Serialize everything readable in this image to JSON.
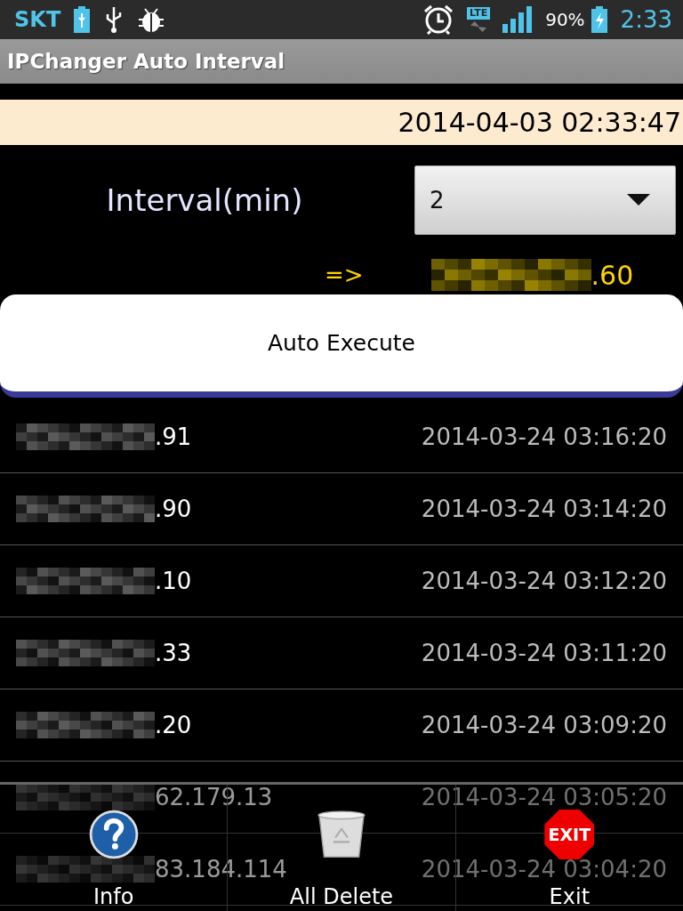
{
  "status_bar": {
    "carrier": "SKT",
    "lte_label": "LTE",
    "battery": "90%",
    "time": "2:33"
  },
  "title": "IPChanger Auto Interval",
  "current_time": "2014-04-03 02:33:47",
  "interval": {
    "label": "Interval(min)",
    "value": "2"
  },
  "result": {
    "arrow": "=>",
    "ip_suffix": ".60"
  },
  "auto_button": "Auto Execute",
  "rows": [
    {
      "ip_suffix": ".91",
      "time": "2014-03-24 03:16:20"
    },
    {
      "ip_suffix": ".90",
      "time": "2014-03-24 03:14:20"
    },
    {
      "ip_suffix": ".10",
      "time": "2014-03-24 03:12:20"
    },
    {
      "ip_suffix": ".33",
      "time": "2014-03-24 03:11:20"
    },
    {
      "ip_suffix": ".20",
      "time": "2014-03-24 03:09:20"
    },
    {
      "ip_suffix": "62.179.13",
      "time": "2014-03-24 03:05:20"
    },
    {
      "ip_suffix": "83.184.114",
      "time": "2014-03-24 03:04:20"
    }
  ],
  "menu": [
    {
      "kind": "help",
      "label": "Info"
    },
    {
      "kind": "trash",
      "label": "All Delete"
    },
    {
      "kind": "exit",
      "label": "Exit",
      "icon_text": "EXIT"
    }
  ]
}
